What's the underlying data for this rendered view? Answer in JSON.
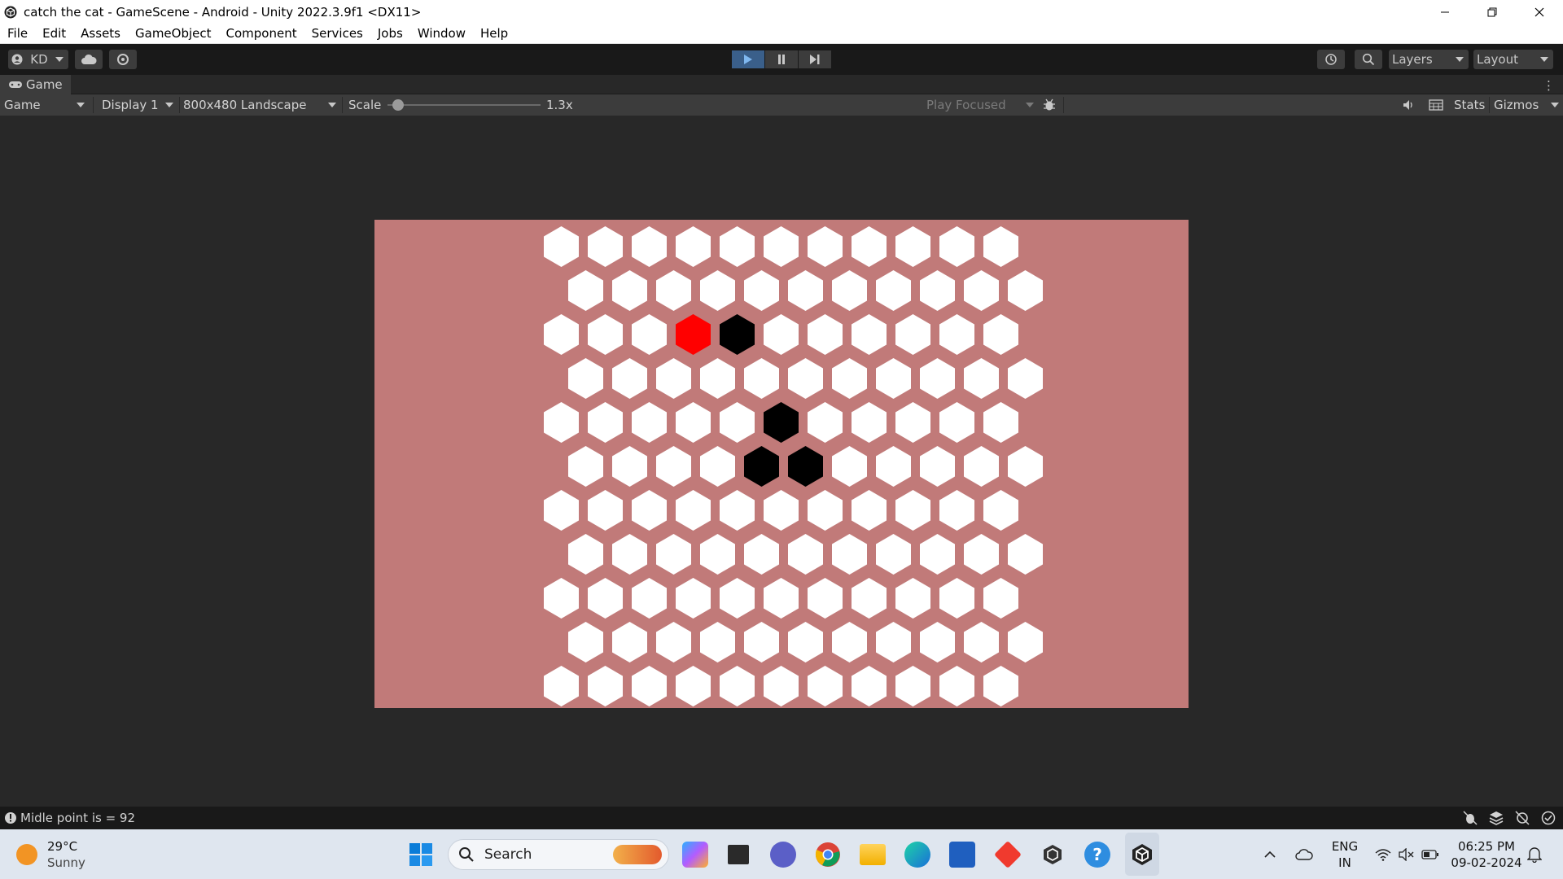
{
  "window": {
    "title": "catch the cat - GameScene - Android - Unity 2022.3.9f1 <DX11>"
  },
  "menu": [
    "File",
    "Edit",
    "Assets",
    "GameObject",
    "Component",
    "Services",
    "Jobs",
    "Window",
    "Help"
  ],
  "toolbar": {
    "account_label": "KD",
    "layers_label": "Layers",
    "layout_label": "Layout"
  },
  "game_tab": {
    "label": "Game"
  },
  "game_bar": {
    "view_select": "Game",
    "display_select": "Display 1",
    "resolution_select": "800x480 Landscape",
    "scale_label": "Scale",
    "scale_value": "1.3x",
    "scale_fraction": 0.07,
    "play_mode_select": "Play Focused",
    "stats_label": "Stats",
    "gizmos_label": "Gizmos"
  },
  "game": {
    "background_color": "#c17a79",
    "cell_color": "#ffffff",
    "blocked_color": "#000000",
    "cat_color": "#ff0000",
    "rows": 11,
    "cols": 11,
    "cat_cell": [
      2,
      3
    ],
    "blocked_cells": [
      [
        2,
        4
      ],
      [
        4,
        5
      ],
      [
        5,
        4
      ],
      [
        5,
        5
      ]
    ]
  },
  "status_bar": {
    "message": "Midle point is = 92"
  },
  "taskbar": {
    "weather_temp": "29°C",
    "weather_desc": "Sunny",
    "search_placeholder": "Search",
    "language_line1": "ENG",
    "language_line2": "IN",
    "time": "06:25 PM",
    "date": "09-02-2024"
  }
}
